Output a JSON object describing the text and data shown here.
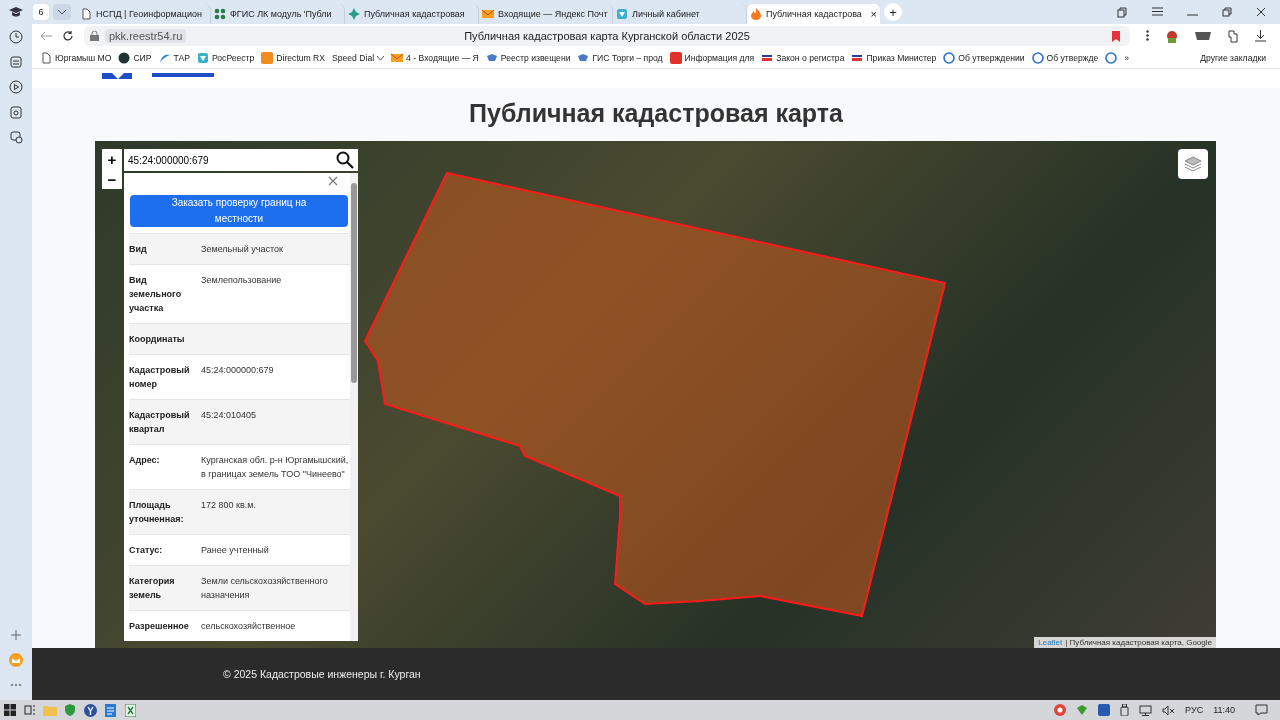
{
  "browser": {
    "tab_count": "6",
    "tabs": [
      {
        "title": "НСПД | Геоинформацион",
        "selected": false
      },
      {
        "title": "ФГИС ЛК модуль 'Публи",
        "selected": false
      },
      {
        "title": "Публичная кадастровая",
        "selected": false
      },
      {
        "title": "Входящие — Яндекс Почт",
        "selected": false
      },
      {
        "title": "Личный кабинет",
        "selected": false
      },
      {
        "title": "Публичная кадастрова",
        "selected": true
      }
    ],
    "close_tab": "×",
    "new_tab": "+",
    "url": "pkk.reestr54.ru",
    "page_title": "Публичная кадастровая карта Курганской области 2025",
    "bookmarks": [
      "Юргамыш МО",
      "СИР",
      "ТАР",
      "РосРеестр",
      "Directum RX",
      "Speed Dial",
      "4 - Входящие — Я",
      "Реестр извещени",
      "ГИС Торги – прод",
      "Информация для",
      "Закон о регистра",
      "Приказ Министер",
      "Об утверждении",
      "Об утвержде"
    ],
    "more": "»",
    "other_bookmarks": "Другие закладки"
  },
  "page": {
    "title": "Публичная кадастровая карта",
    "search": {
      "value": "45:24:000000:679"
    },
    "zoom_in": "+",
    "zoom_out": "−",
    "order_button": "Заказать проверку границ на местности",
    "properties": [
      {
        "label": "Вид",
        "value": "Земельный участок"
      },
      {
        "label": "Вид земельного участка",
        "value": "Землепользование"
      },
      {
        "label": "Координаты"
      },
      {
        "label": "Кадастровый номер",
        "value": "45:24:000000:679"
      },
      {
        "label": "Кадастровый квартал",
        "value": "45:24:010405"
      },
      {
        "label": "Адрес:",
        "value": "Курганская обл. р-н Юргамышский, в границах земель ТОО \"Чинеево\""
      },
      {
        "label": "Площадь уточненная:",
        "value": "172 800 кв.м."
      },
      {
        "label": "Статус:",
        "value": "Ранее учтенный"
      },
      {
        "label": "Категория земель",
        "value": "Земли сельскохозяйственного назначения"
      },
      {
        "label": "Разрешенное",
        "value": "сельскохозяйственное"
      }
    ],
    "attribution": {
      "link": "Leaflet",
      "text": "| Публичная кадастровая карта, Google"
    },
    "footer": "© 2025 Кадастровые инженеры г. Курган"
  },
  "taskbar": {
    "language": "РУС",
    "time": "11:40"
  }
}
